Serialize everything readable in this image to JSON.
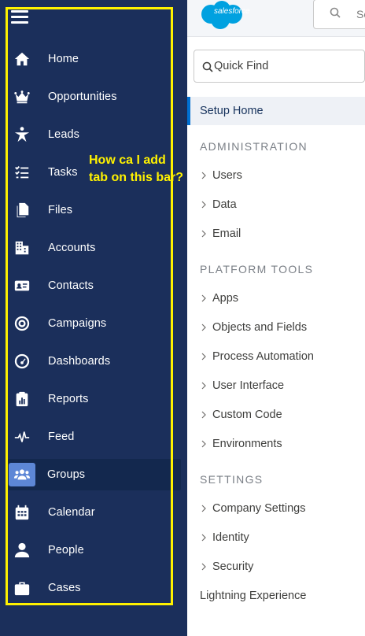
{
  "sidebar": {
    "items": [
      {
        "label": "Home",
        "icon": "home-icon"
      },
      {
        "label": "Opportunities",
        "icon": "crown-icon"
      },
      {
        "label": "Leads",
        "icon": "star-person-icon"
      },
      {
        "label": "Tasks",
        "icon": "task-list-icon"
      },
      {
        "label": "Files",
        "icon": "files-icon"
      },
      {
        "label": "Accounts",
        "icon": "building-icon"
      },
      {
        "label": "Contacts",
        "icon": "contact-card-icon"
      },
      {
        "label": "Campaigns",
        "icon": "target-icon"
      },
      {
        "label": "Dashboards",
        "icon": "gauge-icon"
      },
      {
        "label": "Reports",
        "icon": "clipboard-chart-icon"
      },
      {
        "label": "Feed",
        "icon": "pulse-icon"
      },
      {
        "label": "Groups",
        "icon": "groups-icon",
        "active": true
      },
      {
        "label": "Calendar",
        "icon": "calendar-icon"
      },
      {
        "label": "People",
        "icon": "person-icon"
      },
      {
        "label": "Cases",
        "icon": "briefcase-icon"
      }
    ]
  },
  "annotation": {
    "line1": "How ca I add",
    "line2": "tab on this bar?"
  },
  "header": {
    "logo_text": "salesforce",
    "search_placeholder": "Se"
  },
  "setup": {
    "quick_find_placeholder": "Quick Find",
    "setup_home": "Setup Home",
    "sections": [
      {
        "title": "ADMINISTRATION",
        "items": [
          "Users",
          "Data",
          "Email"
        ]
      },
      {
        "title": "PLATFORM TOOLS",
        "items": [
          "Apps",
          "Objects and Fields",
          "Process Automation",
          "User Interface",
          "Custom Code",
          "Environments"
        ]
      },
      {
        "title": "SETTINGS",
        "items": [
          "Company Settings",
          "Identity",
          "Security"
        ]
      }
    ],
    "footer_link": "Lightning Experience"
  },
  "colors": {
    "nav_bg": "#1b2f5b",
    "highlight": "#fff200",
    "accent": "#0070d2",
    "logo": "#00a1e0"
  }
}
